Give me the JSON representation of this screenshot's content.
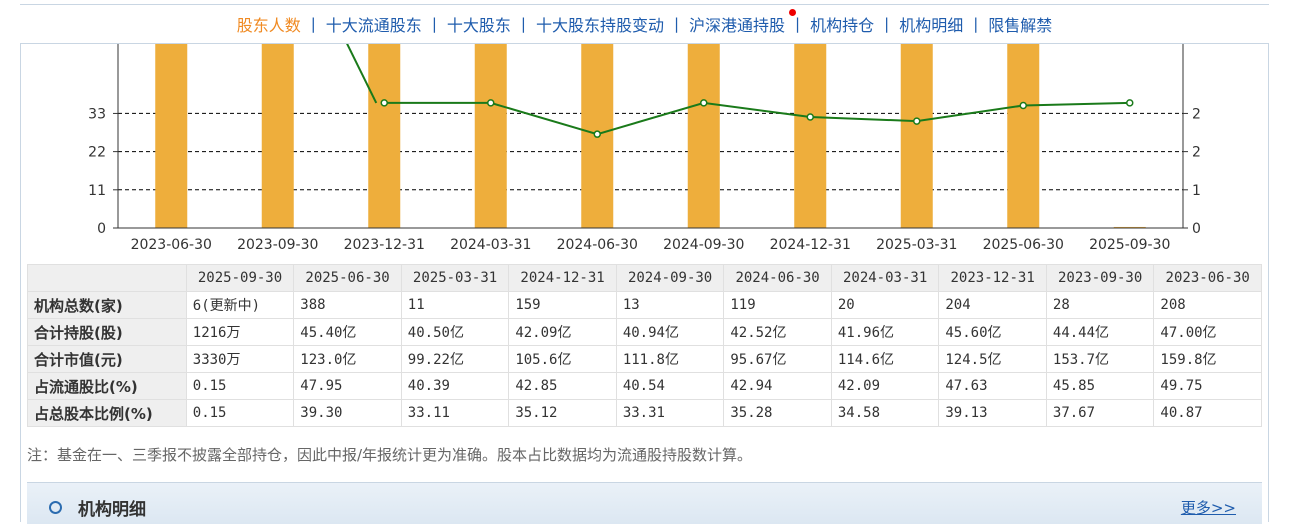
{
  "tabs": [
    {
      "label": "股东人数",
      "active": true
    },
    {
      "label": "十大流通股东",
      "active": false
    },
    {
      "label": "十大股东",
      "active": false
    },
    {
      "label": "十大股东持股变动",
      "active": false
    },
    {
      "label": "沪深港通持股",
      "active": false,
      "badge": "red-dot"
    },
    {
      "label": "机构持仓",
      "active": false
    },
    {
      "label": "机构明细",
      "active": false
    },
    {
      "label": "限售解禁",
      "active": false
    }
  ],
  "tab_separator": "|",
  "chart_data": {
    "type": "bar",
    "categories": [
      "2023-06-30",
      "2023-09-30",
      "2023-12-31",
      "2024-03-31",
      "2024-06-30",
      "2024-09-30",
      "2024-12-31",
      "2025-03-31",
      "2025-06-30",
      "2025-09-30"
    ],
    "left_axis_ticks": [
      "0",
      "11",
      "22",
      "33"
    ],
    "right_axis_ticks": [
      "0",
      "1",
      "2",
      "2"
    ],
    "ylim_left": [
      0,
      50
    ],
    "ylim_right": [
      0,
      3.45
    ],
    "grid": true,
    "colors": {
      "bar": "#eeae3c",
      "line": "#1a7a1a",
      "grid": "#000000"
    },
    "series": [
      {
        "type": "bar",
        "axis": "left",
        "values": [
          60,
          60,
          60,
          60,
          60,
          60,
          60,
          60,
          60,
          0.3
        ]
      },
      {
        "type": "line",
        "axis": "right",
        "values": [
          null,
          null,
          2.4,
          2.4,
          1.8,
          2.4,
          2.13,
          2.05,
          2.35,
          2.4
        ]
      }
    ]
  },
  "table": {
    "columns": [
      "2025-09-30",
      "2025-06-30",
      "2025-03-31",
      "2024-12-31",
      "2024-09-30",
      "2024-06-30",
      "2024-03-31",
      "2023-12-31",
      "2023-09-30",
      "2023-06-30"
    ],
    "rows": [
      {
        "label": "机构总数(家)",
        "values": [
          "6(更新中)",
          "388",
          "11",
          "159",
          "13",
          "119",
          "20",
          "204",
          "28",
          "208"
        ]
      },
      {
        "label": "合计持股(股)",
        "values": [
          "1216万",
          "45.40亿",
          "40.50亿",
          "42.09亿",
          "40.94亿",
          "42.52亿",
          "41.96亿",
          "45.60亿",
          "44.44亿",
          "47.00亿"
        ]
      },
      {
        "label": "合计市值(元)",
        "values": [
          "3330万",
          "123.0亿",
          "99.22亿",
          "105.6亿",
          "111.8亿",
          "95.67亿",
          "114.6亿",
          "124.5亿",
          "153.7亿",
          "159.8亿"
        ]
      },
      {
        "label": "占流通股比(%)",
        "values": [
          "0.15",
          "47.95",
          "40.39",
          "42.85",
          "40.54",
          "42.94",
          "42.09",
          "47.63",
          "45.85",
          "49.75"
        ]
      },
      {
        "label": "占总股本比例(%)",
        "values": [
          "0.15",
          "39.30",
          "33.11",
          "35.12",
          "33.31",
          "35.28",
          "34.58",
          "39.13",
          "37.67",
          "40.87"
        ]
      }
    ]
  },
  "note": "注：基金在一、三季报不披露全部持仓，因此中报/年报统计更为准确。股本占比数据均为流通股持股数计算。",
  "section": {
    "title": "机构明细",
    "more": "更多>>",
    "icon": "circle-bullet-icon"
  }
}
